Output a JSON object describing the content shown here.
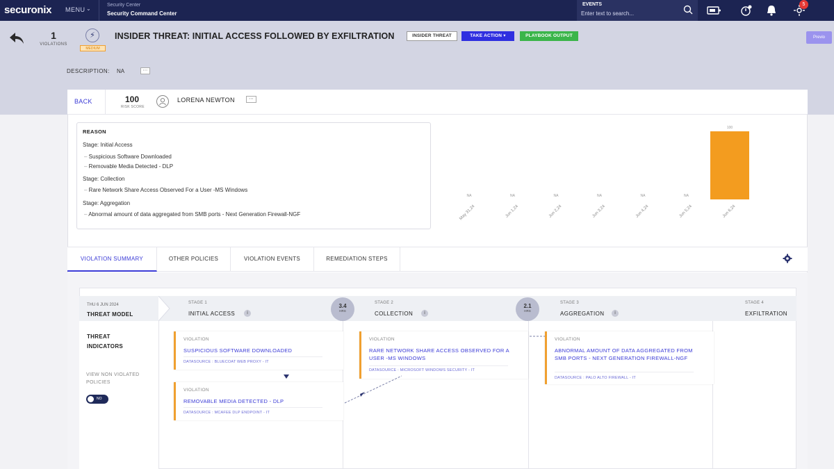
{
  "topbar": {
    "logo": "securonix",
    "menu_label": "MENU",
    "breadcrumb_top": "Security Center",
    "breadcrumb_main": "Security Command Center",
    "events_label": "EVENTS",
    "events_placeholder": "Enter text to search...",
    "notification_count": "5"
  },
  "header": {
    "violations_count": "1",
    "violations_label": "VIOLATIONS",
    "severity_tag": "MEDIUM",
    "title": "INSIDER THREAT: INITIAL ACCESS FOLLOWED BY EXFILTRATION",
    "pill_insider": "INSIDER THREAT",
    "pill_action": "TAKE ACTION",
    "pill_playbook": "PLAYBOOK OUTPUT",
    "prev_button": "Previo",
    "description_label": "DESCRIPTION:",
    "description_value": "NA"
  },
  "user_row": {
    "back": "BACK",
    "risk_score": "100",
    "risk_label": "RISK SCORE",
    "user_name": "LORENA NEWTON"
  },
  "reason": {
    "title": "REASON",
    "stage1": "Stage: Initial Access",
    "stage1_items": [
      "Suspicious Software Downloaded",
      "Removable Media Detected - DLP"
    ],
    "stage2": "Stage: Collection",
    "stage2_items": [
      "Rare Network Share Access Observed For a User -MS Windows"
    ],
    "stage3": "Stage: Aggregation",
    "stage3_items": [
      "Abnormal amount of data aggregated from SMB ports - Next Generation Firewall-NGF"
    ]
  },
  "chart_data": {
    "type": "bar",
    "categories": [
      "May 31,24",
      "Jun 1,24",
      "Jun 2,24",
      "Jun 3,24",
      "Jun 4,24",
      "Jun 5,24",
      "Jun 6,24"
    ],
    "values": [
      0,
      0,
      0,
      0,
      0,
      0,
      100
    ],
    "data_labels": [
      "NA",
      "NA",
      "NA",
      "NA",
      "NA",
      "NA",
      "100"
    ],
    "bar_color": "#f39c1f",
    "grid": false
  },
  "tabs": [
    "VIOLATION SUMMARY",
    "OTHER POLICIES",
    "VIOLATION EVENTS",
    "REMEDIATION STEPS"
  ],
  "flow": {
    "date": "THU 6 JUN 2024",
    "threat_model": "THREAT MODEL",
    "threat_indicators": "THREAT INDICATORS",
    "view_non_violated": "VIEW NON VIOLATED POLICIES",
    "toggle_text": "NO",
    "stages": [
      {
        "num": "STAGE 1",
        "name": "INITIAL ACCESS"
      },
      {
        "num": "STAGE 2",
        "name": "COLLECTION"
      },
      {
        "num": "STAGE 3",
        "name": "AGGREGATION"
      },
      {
        "num": "STAGE 4",
        "name": "EXFILTRATION"
      }
    ],
    "gaps": [
      {
        "value": "3.4",
        "unit": "HRS"
      },
      {
        "value": "2.1",
        "unit": "HRS"
      }
    ],
    "violations": [
      {
        "label": "VIOLATION",
        "title": "SUSPICIOUS SOFTWARE DOWNLOADED",
        "datasource": "DATASOURCE : BLUECOAT WEB PROXY - IT"
      },
      {
        "label": "VIOLATION",
        "title": "REMOVABLE MEDIA DETECTED - DLP",
        "datasource": "DATASOURCE : MCAFEE DLP ENDPOINT - IT"
      },
      {
        "label": "VIOLATION",
        "title": "RARE NETWORK SHARE ACCESS OBSERVED FOR A USER -MS WINDOWS",
        "datasource": "DATASOURCE : MICROSOFT WINDOWS SECURITY - IT"
      },
      {
        "label": "VIOLATION",
        "title": "ABNORMAL AMOUNT OF DATA AGGREGATED FROM SMB PORTS - NEXT GENERATION FIREWALL-NGF",
        "datasource": "DATASOURCE : PALO ALTO FIREWALL - IT"
      }
    ]
  },
  "colors": {
    "topbar": "#1c2452",
    "accent": "#3a3ad6",
    "take_action": "#2f2fe0",
    "playbook": "#3bb54a",
    "violation_border": "#f0a030"
  }
}
